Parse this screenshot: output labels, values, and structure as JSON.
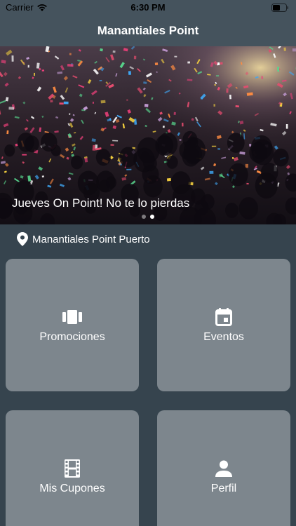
{
  "status_bar": {
    "carrier": "Carrier",
    "time": "6:30 PM"
  },
  "nav": {
    "title": "Manantiales Point"
  },
  "banner": {
    "caption": "Jueves On Point! No te lo pierdas",
    "page_count": 2,
    "active_page": 2
  },
  "location": {
    "label": "Manantiales Point Puerto",
    "icon": "location-pin-icon"
  },
  "tiles": [
    {
      "label": "Promociones",
      "icon": "carousel-icon"
    },
    {
      "label": "Eventos",
      "icon": "calendar-icon"
    },
    {
      "label": "Mis Cupones",
      "icon": "film-strip-icon"
    },
    {
      "label": "Perfil",
      "icon": "person-icon"
    }
  ],
  "colors": {
    "background": "#36444e",
    "bar": "#45535d",
    "tile": "#7d868d"
  }
}
